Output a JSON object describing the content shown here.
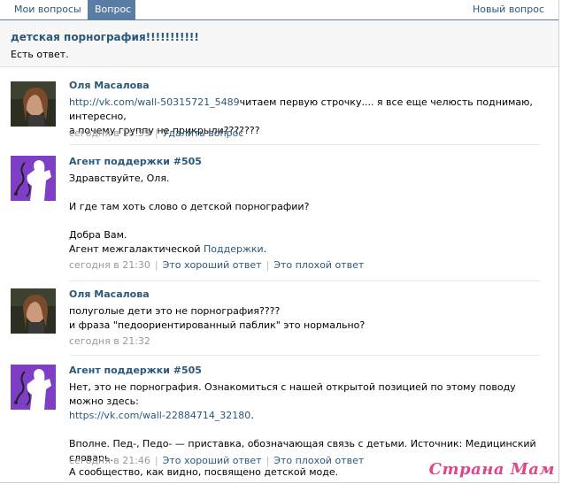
{
  "tabs": {
    "my_questions": "Мои вопросы",
    "question": "Вопрос",
    "new_question": "Новый вопрос"
  },
  "question": {
    "title": "детская порнография!!!!!!!!!!!",
    "status": "Есть ответ."
  },
  "posts": [
    {
      "author": "Оля Масалова",
      "link": "http://vk.com/wall-50315721_5489",
      "text_after_link": "читаем первую строчку.... я все еще челюсть поднимаю, интересно,",
      "line2": "а почему группу не прикрыли???????",
      "time": "сегодня в 15:59",
      "action1": "Удалить вопрос"
    },
    {
      "author": "Агент поддержки #505",
      "line1": "Здравствуйте, Оля.",
      "line2": "И где там хоть слово о детской порнографии?",
      "line3": "Добра Вам.",
      "line4_prefix": "Агент межгалактической ",
      "line4_link": "Поддержки",
      "line4_suffix": ".",
      "time": "сегодня в 21:30",
      "action1": "Это хороший ответ",
      "action2": "Это плохой ответ"
    },
    {
      "author": "Оля Масалова",
      "line1": "полуголые дети это не порнография????",
      "line2": "и фраза \"педоориентированный паблик\" это нормально?",
      "time": "сегодня в 21:32"
    },
    {
      "author": "Агент поддержки #505",
      "line1": "Нет, это не порнография. Ознакомиться с нашей открытой позицией по этому поводу можно здесь:",
      "link": "https://vk.com/wall-22884714_32180",
      "link_suffix": ".",
      "line3": "Вполне. Пед-, Педо- — приставка, обозначающая связь с детьми. Источник: Медицинский словарь.",
      "line4": "А сообщество, как видно, посвящено детской моде.",
      "time": "сегодня в 21:46",
      "action1": "Это хороший ответ",
      "action2": "Это плохой ответ"
    }
  ],
  "watermark": "Страна Мам",
  "icons": {
    "user_avatar": "user-photo-avatar",
    "agent_avatar": "support-agent-avatar"
  },
  "colors": {
    "accent": "#597da3",
    "link": "#2b587a",
    "agent_avatar_bg": "#7e3fc6",
    "watermark": "#e0478b"
  }
}
